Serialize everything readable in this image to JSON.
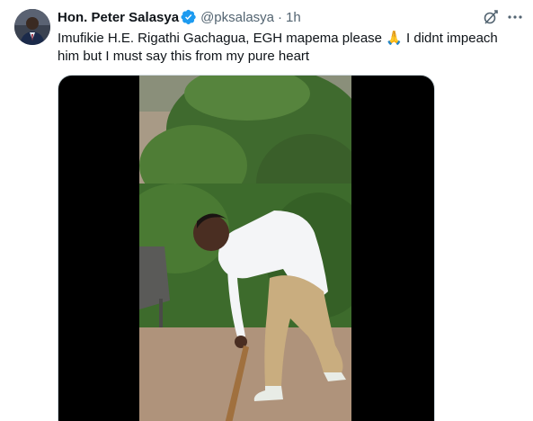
{
  "tweet": {
    "display_name": "Hon. Peter Salasya",
    "handle": "@pksalasya",
    "separator": "·",
    "time": "1h",
    "text_before_emoji": "Imufikie H.E. Rigathi Gachagua, EGH mapema please ",
    "emoji": "🙏",
    "text_after_emoji": " I didnt impeach him but I must say this from my pure heart",
    "verified": true
  },
  "icons": {
    "avatar": "profile-photo",
    "verified": "verified-badge-icon",
    "grok": "grok-icon",
    "more": "more-icon"
  },
  "media": {
    "type": "video-thumbnail"
  },
  "colors": {
    "text": "#0f1419",
    "secondary_text": "#536471",
    "verified_blue": "#1d9bf0",
    "media_background": "#000000"
  }
}
